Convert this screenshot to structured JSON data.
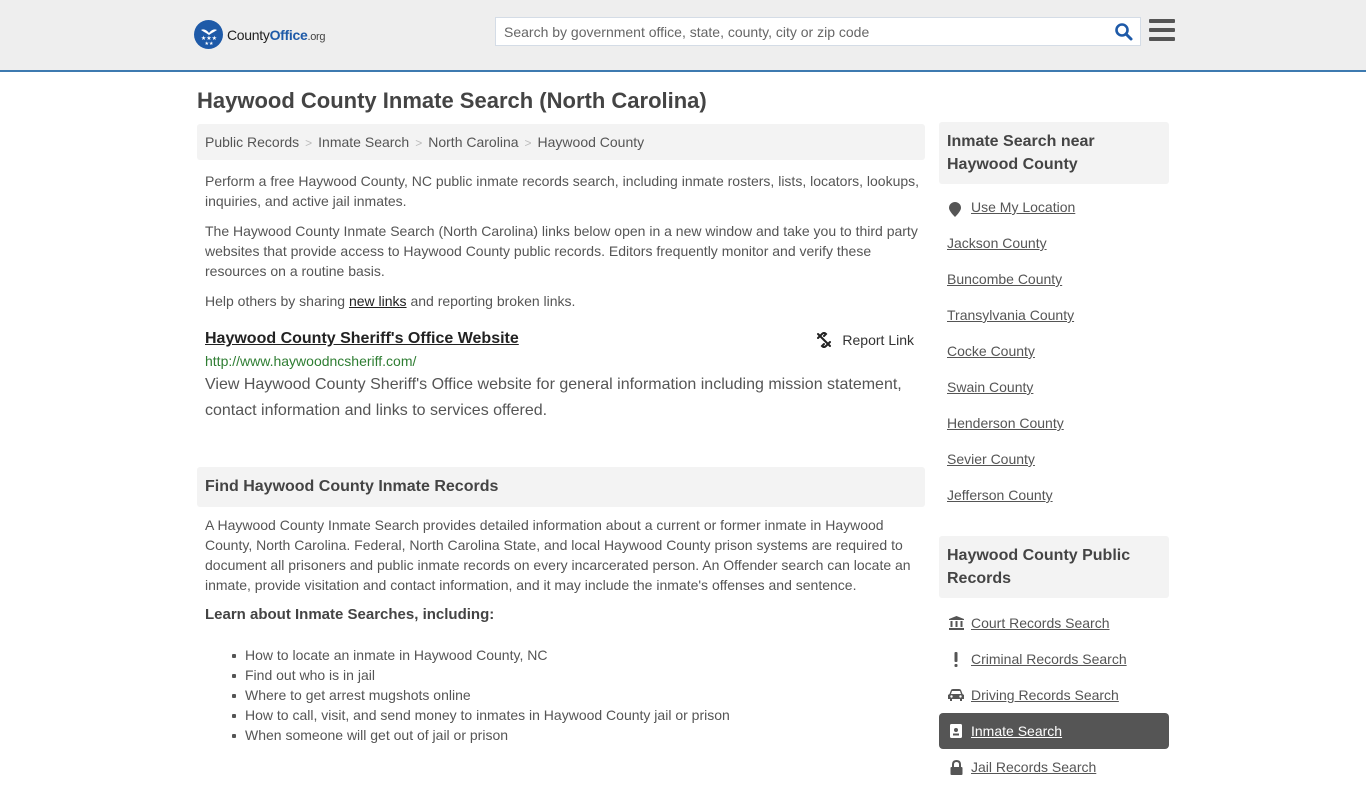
{
  "header": {
    "logo": {
      "part1": "County",
      "part2": "Office",
      "part3": ".org"
    },
    "search": {
      "placeholder": "Search by government office, state, county, city or zip code",
      "value": ""
    },
    "search_icon": "search-icon",
    "menu_icon": "hamburger-menu-icon",
    "accent_color": "#3d7ab0",
    "brand_color": "#1e5aa8"
  },
  "page": {
    "title": "Haywood County Inmate Search (North Carolina)",
    "breadcrumb": [
      "Public Records",
      "Inmate Search",
      "North Carolina",
      "Haywood County"
    ],
    "intro": {
      "p1": "Perform a free Haywood County, NC public inmate records search, including inmate rosters, lists, locators, lookups, inquiries, and active jail inmates.",
      "p2": "The Haywood County Inmate Search (North Carolina) links below open in a new window and take you to third party websites that provide access to Haywood County public records. Editors frequently monitor and verify these resources on a routine basis.",
      "p3_before": "Help others by sharing ",
      "p3_link": "new links",
      "p3_after": " and reporting broken links."
    },
    "result": {
      "title": "Haywood County Sheriff's Office Website",
      "report_label": "Report Link",
      "url": "http://www.haywoodncsheriff.com/",
      "description": "View Haywood County Sheriff's Office website for general information including mission statement, contact information and links to services offered."
    },
    "section": {
      "heading": "Find Haywood County Inmate Records",
      "body": "A Haywood County Inmate Search provides detailed information about a current or former inmate in Haywood County, North Carolina. Federal, North Carolina State, and local Haywood County prison systems are required to document all prisoners and public inmate records on every incarcerated person. An Offender search can locate an inmate, provide visitation and contact information, and it may include the inmate's offenses and sentence.",
      "learn_heading": "Learn about Inmate Searches, including:",
      "bullets": [
        "How to locate an inmate in Haywood County, NC",
        "Find out who is in jail",
        "Where to get arrest mugshots online",
        "How to call, visit, and send money to inmates in Haywood County jail or prison",
        "When someone will get out of jail or prison"
      ]
    }
  },
  "sidebar": {
    "near": {
      "heading": "Inmate Search near Haywood County",
      "use_location": "Use My Location",
      "counties": [
        "Jackson County",
        "Buncombe County",
        "Transylvania County",
        "Cocke County",
        "Swain County",
        "Henderson County",
        "Sevier County",
        "Jefferson County"
      ]
    },
    "records": {
      "heading": "Haywood County Public Records",
      "items": [
        {
          "label": "Court Records Search",
          "icon": "courthouse-icon",
          "active": false
        },
        {
          "label": "Criminal Records Search",
          "icon": "exclamation-icon",
          "active": false
        },
        {
          "label": "Driving Records Search",
          "icon": "car-icon",
          "active": false
        },
        {
          "label": "Inmate Search",
          "icon": "id-badge-icon",
          "active": true
        },
        {
          "label": "Jail Records Search",
          "icon": "lock-icon",
          "active": false
        }
      ]
    }
  }
}
